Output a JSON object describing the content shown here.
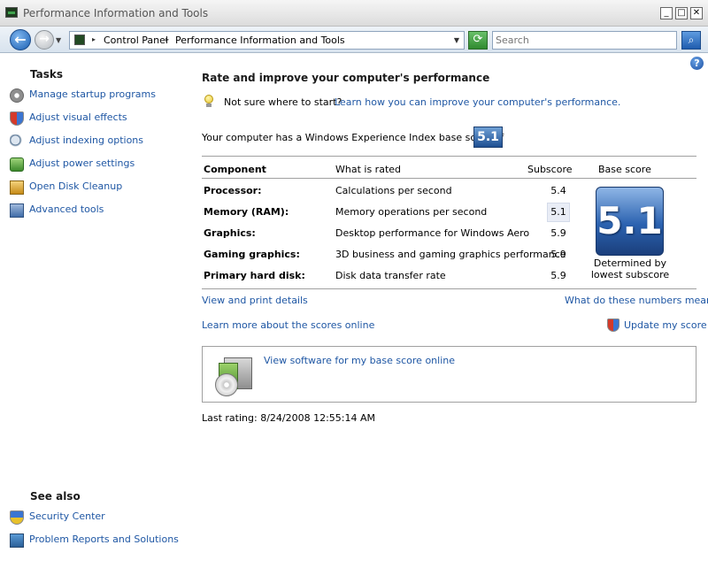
{
  "window": {
    "title": "Performance Information and Tools",
    "min": "_",
    "max": "□",
    "close": "✕"
  },
  "nav": {
    "back": "←",
    "forward": "→",
    "breadcrumbs": [
      "Control Panel",
      "Performance Information and Tools"
    ],
    "search_placeholder": "Search",
    "refresh": "⟳",
    "search_button": "⌕"
  },
  "sidebar": {
    "tasks_heading": "Tasks",
    "tasks": [
      {
        "label": "Manage startup programs",
        "icon": "startup-programs-icon"
      },
      {
        "label": "Adjust visual effects",
        "icon": "shield-icon"
      },
      {
        "label": "Adjust indexing options",
        "icon": "indexing-icon"
      },
      {
        "label": "Adjust power settings",
        "icon": "power-icon"
      },
      {
        "label": "Open Disk Cleanup",
        "icon": "disk-cleanup-icon"
      },
      {
        "label": "Advanced tools",
        "icon": "advanced-tools-icon"
      }
    ],
    "see_also_heading": "See also",
    "see_also": [
      {
        "label": "Security Center",
        "icon": "security-center-icon"
      },
      {
        "label": "Problem Reports and Solutions",
        "icon": "problem-reports-icon"
      }
    ]
  },
  "main": {
    "heading": "Rate and improve your computer's performance",
    "not_sure": "Not sure where to start?",
    "learn_link": "Learn how you can improve your computer's performance.",
    "score_line": "Your computer has a Windows Experience Index base score of",
    "base_score": "5.1",
    "table": {
      "headers": {
        "component": "Component",
        "what": "What is rated",
        "subscore": "Subscore",
        "base": "Base score"
      },
      "rows": [
        {
          "component": "Processor:",
          "what": "Calculations per second",
          "subscore": "5.4"
        },
        {
          "component": "Memory (RAM):",
          "what": "Memory operations per second",
          "subscore": "5.1"
        },
        {
          "component": "Graphics:",
          "what": "Desktop performance for Windows Aero",
          "subscore": "5.9"
        },
        {
          "component": "Gaming graphics:",
          "what": "3D business and gaming graphics performance",
          "subscore": "5.9"
        },
        {
          "component": "Primary hard disk:",
          "what": "Disk data transfer rate",
          "subscore": "5.9"
        }
      ],
      "determined_line1": "Determined by",
      "determined_line2": "lowest subscore"
    },
    "view_print": "View and print details",
    "what_numbers": "What do these numbers mean?",
    "learn_scores": "Learn more about the scores online",
    "update_score": "Update my score",
    "software_link": "View software for my base score online",
    "last_rating": "Last rating: 8/24/2008 12:55:14 AM",
    "help": "?"
  }
}
